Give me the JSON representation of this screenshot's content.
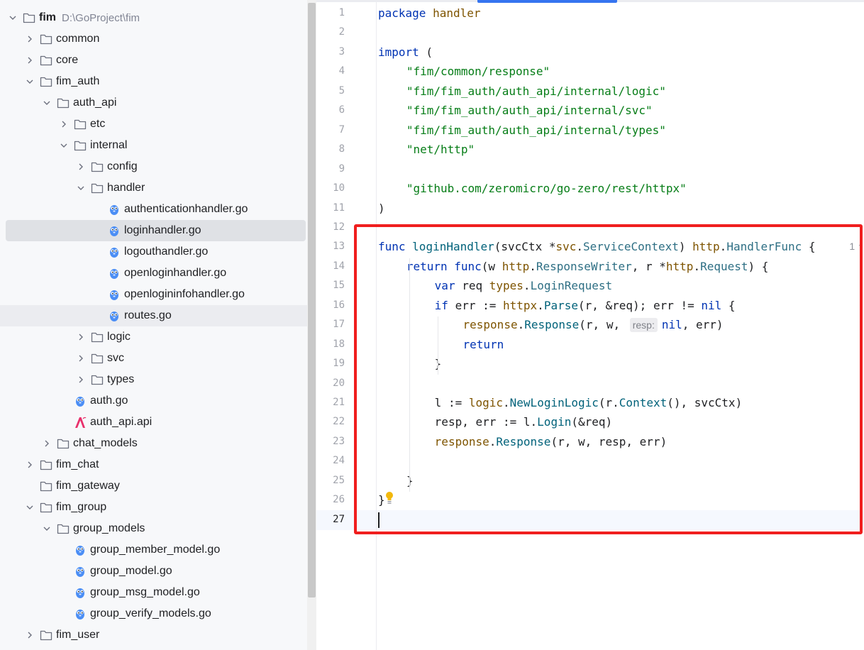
{
  "project_tree": {
    "items": [
      {
        "depth": 0,
        "chevron": "down",
        "icon": "folder-icon",
        "label": "fim",
        "bold": true,
        "path": "D:\\GoProject\\fim"
      },
      {
        "depth": 1,
        "chevron": "right",
        "icon": "folder-icon",
        "label": "common"
      },
      {
        "depth": 1,
        "chevron": "right",
        "icon": "folder-icon",
        "label": "core"
      },
      {
        "depth": 1,
        "chevron": "down",
        "icon": "folder-icon",
        "label": "fim_auth"
      },
      {
        "depth": 2,
        "chevron": "down",
        "icon": "folder-icon",
        "label": "auth_api"
      },
      {
        "depth": 3,
        "chevron": "right",
        "icon": "folder-icon",
        "label": "etc"
      },
      {
        "depth": 3,
        "chevron": "down",
        "icon": "folder-icon",
        "label": "internal"
      },
      {
        "depth": 4,
        "chevron": "right",
        "icon": "folder-icon",
        "label": "config"
      },
      {
        "depth": 4,
        "chevron": "down",
        "icon": "folder-icon",
        "label": "handler"
      },
      {
        "depth": 5,
        "chevron": "none",
        "icon": "go-file-icon",
        "label": "authenticationhandler.go"
      },
      {
        "depth": 5,
        "chevron": "none",
        "icon": "go-file-icon",
        "label": "loginhandler.go",
        "state": "selected"
      },
      {
        "depth": 5,
        "chevron": "none",
        "icon": "go-file-icon",
        "label": "logouthandler.go"
      },
      {
        "depth": 5,
        "chevron": "none",
        "icon": "go-file-icon",
        "label": "openloginhandler.go"
      },
      {
        "depth": 5,
        "chevron": "none",
        "icon": "go-file-icon",
        "label": "openlogininfohandler.go"
      },
      {
        "depth": 5,
        "chevron": "none",
        "icon": "go-file-icon",
        "label": "routes.go",
        "state": "hover"
      },
      {
        "depth": 4,
        "chevron": "right",
        "icon": "folder-icon",
        "label": "logic"
      },
      {
        "depth": 4,
        "chevron": "right",
        "icon": "folder-icon",
        "label": "svc"
      },
      {
        "depth": 4,
        "chevron": "right",
        "icon": "folder-icon",
        "label": "types"
      },
      {
        "depth": 3,
        "chevron": "none",
        "icon": "go-file-icon",
        "label": "auth.go"
      },
      {
        "depth": 3,
        "chevron": "none",
        "icon": "api-file-icon",
        "label": "auth_api.api"
      },
      {
        "depth": 2,
        "chevron": "right",
        "icon": "folder-icon",
        "label": "chat_models"
      },
      {
        "depth": 1,
        "chevron": "right",
        "icon": "folder-icon",
        "label": "fim_chat"
      },
      {
        "depth": 1,
        "chevron": "none",
        "icon": "folder-icon",
        "label": "fim_gateway"
      },
      {
        "depth": 1,
        "chevron": "down",
        "icon": "folder-icon",
        "label": "fim_group"
      },
      {
        "depth": 2,
        "chevron": "down",
        "icon": "folder-icon",
        "label": "group_models"
      },
      {
        "depth": 3,
        "chevron": "none",
        "icon": "go-file-icon",
        "label": "group_member_model.go"
      },
      {
        "depth": 3,
        "chevron": "none",
        "icon": "go-file-icon",
        "label": "group_model.go"
      },
      {
        "depth": 3,
        "chevron": "none",
        "icon": "go-file-icon",
        "label": "group_msg_model.go"
      },
      {
        "depth": 3,
        "chevron": "none",
        "icon": "go-file-icon",
        "label": "group_verify_models.go"
      },
      {
        "depth": 1,
        "chevron": "right",
        "icon": "folder-icon",
        "label": "fim_user"
      }
    ]
  },
  "editor": {
    "current_line": "27",
    "usages_hint": "1",
    "inlay_hint": "resp:",
    "lines": [
      {
        "n": "1",
        "indent": 0,
        "tokens": [
          [
            "kw",
            "package"
          ],
          [
            "p",
            " "
          ],
          [
            "pkg",
            "handler"
          ]
        ]
      },
      {
        "n": "2",
        "indent": 0,
        "tokens": []
      },
      {
        "n": "3",
        "indent": 0,
        "tokens": [
          [
            "kw",
            "import"
          ],
          [
            "p",
            " ("
          ]
        ]
      },
      {
        "n": "4",
        "indent": 1,
        "tokens": [
          [
            "str",
            "\"fim/common/response\""
          ]
        ]
      },
      {
        "n": "5",
        "indent": 1,
        "tokens": [
          [
            "str",
            "\"fim/fim_auth/auth_api/internal/logic\""
          ]
        ]
      },
      {
        "n": "6",
        "indent": 1,
        "tokens": [
          [
            "str",
            "\"fim/fim_auth/auth_api/internal/svc\""
          ]
        ]
      },
      {
        "n": "7",
        "indent": 1,
        "tokens": [
          [
            "str",
            "\"fim/fim_auth/auth_api/internal/types\""
          ]
        ]
      },
      {
        "n": "8",
        "indent": 1,
        "tokens": [
          [
            "str",
            "\"net/http\""
          ]
        ]
      },
      {
        "n": "9",
        "indent": 0,
        "tokens": []
      },
      {
        "n": "10",
        "indent": 1,
        "tokens": [
          [
            "str",
            "\"github.com/zeromicro/go-zero/rest/httpx\""
          ]
        ]
      },
      {
        "n": "11",
        "indent": 0,
        "tokens": [
          [
            "p",
            ")"
          ]
        ]
      },
      {
        "n": "12",
        "indent": 0,
        "tokens": []
      },
      {
        "n": "13",
        "indent": 0,
        "tokens": [
          [
            "kw",
            "func"
          ],
          [
            "p",
            " "
          ],
          [
            "fn",
            "loginHandler"
          ],
          [
            "p",
            "(svcCtx *"
          ],
          [
            "pkg",
            "svc"
          ],
          [
            "p",
            "."
          ],
          [
            "typ",
            "ServiceContext"
          ],
          [
            "p",
            ") "
          ],
          [
            "pkg",
            "http"
          ],
          [
            "p",
            "."
          ],
          [
            "typ",
            "HandlerFunc"
          ],
          [
            "p",
            " {"
          ]
        ]
      },
      {
        "n": "14",
        "indent": 1,
        "tokens": [
          [
            "kw",
            "return"
          ],
          [
            "p",
            " "
          ],
          [
            "kw",
            "func"
          ],
          [
            "p",
            "(w "
          ],
          [
            "pkg",
            "http"
          ],
          [
            "p",
            "."
          ],
          [
            "typ",
            "ResponseWriter"
          ],
          [
            "p",
            ", r *"
          ],
          [
            "pkg",
            "http"
          ],
          [
            "p",
            "."
          ],
          [
            "typ",
            "Request"
          ],
          [
            "p",
            ") {"
          ]
        ]
      },
      {
        "n": "15",
        "indent": 2,
        "tokens": [
          [
            "kw",
            "var"
          ],
          [
            "p",
            " req "
          ],
          [
            "pkg",
            "types"
          ],
          [
            "p",
            "."
          ],
          [
            "typ",
            "LoginRequest"
          ]
        ]
      },
      {
        "n": "16",
        "indent": 2,
        "tokens": [
          [
            "kw",
            "if"
          ],
          [
            "p",
            " err := "
          ],
          [
            "pkg",
            "httpx"
          ],
          [
            "p",
            "."
          ],
          [
            "call",
            "Parse"
          ],
          [
            "p",
            "(r, &req); err != "
          ],
          [
            "kw",
            "nil"
          ],
          [
            "p",
            " {"
          ]
        ]
      },
      {
        "n": "17",
        "indent": 3,
        "tokens": [
          [
            "pkg",
            "response"
          ],
          [
            "p",
            "."
          ],
          [
            "call",
            "Response"
          ],
          [
            "p",
            "(r, w, "
          ],
          [
            "hint",
            "resp:"
          ],
          [
            "kw",
            "nil"
          ],
          [
            "p",
            ", err)"
          ]
        ]
      },
      {
        "n": "18",
        "indent": 3,
        "tokens": [
          [
            "kw",
            "return"
          ]
        ]
      },
      {
        "n": "19",
        "indent": 2,
        "tokens": [
          [
            "p",
            "}"
          ]
        ]
      },
      {
        "n": "20",
        "indent": 0,
        "tokens": []
      },
      {
        "n": "21",
        "indent": 2,
        "tokens": [
          [
            "p",
            "l := "
          ],
          [
            "pkg",
            "logic"
          ],
          [
            "p",
            "."
          ],
          [
            "call",
            "NewLoginLogic"
          ],
          [
            "p",
            "(r."
          ],
          [
            "call",
            "Context"
          ],
          [
            "p",
            "(), svcCtx)"
          ]
        ]
      },
      {
        "n": "22",
        "indent": 2,
        "tokens": [
          [
            "p",
            "resp, err := l."
          ],
          [
            "call",
            "Login"
          ],
          [
            "p",
            "(&req)"
          ]
        ]
      },
      {
        "n": "23",
        "indent": 2,
        "tokens": [
          [
            "pkg",
            "response"
          ],
          [
            "p",
            "."
          ],
          [
            "call",
            "Response"
          ],
          [
            "p",
            "(r, w, resp, err)"
          ]
        ]
      },
      {
        "n": "24",
        "indent": 0,
        "tokens": []
      },
      {
        "n": "25",
        "indent": 1,
        "tokens": [
          [
            "p",
            "}"
          ]
        ]
      },
      {
        "n": "26",
        "indent": 0,
        "tokens": [
          [
            "p",
            "}"
          ]
        ]
      },
      {
        "n": "27",
        "indent": 0,
        "tokens": []
      }
    ]
  },
  "colors": {
    "highlight_box": "#f01e1e",
    "keyword": "#0033b3",
    "string": "#067d17",
    "package": "#7e5400",
    "function": "#00627a",
    "accent": "#3574f0"
  }
}
